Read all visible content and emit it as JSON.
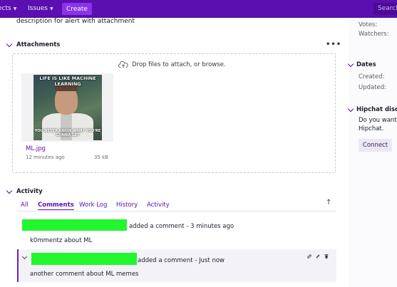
{
  "topbar": {
    "nav_items": [
      {
        "label": "ects",
        "has_caret": true
      },
      {
        "label": "Issues",
        "has_caret": true
      }
    ],
    "create_label": "Create",
    "search_placeholder": "Search"
  },
  "issue": {
    "description": "description for alert with attachment"
  },
  "attachments": {
    "heading": "Attachments",
    "more_label": "•••",
    "drop_text": "Drop files to attach, or browse.",
    "files": [
      {
        "name": "ML.jpg",
        "age": "12 minutes ago",
        "size": "35 kB",
        "meme_top": "LIFE IS LIKE MACHINE LEARNING",
        "meme_bottom": "YOU NEVER KNOW WHAT YOU'RE GONNA GET"
      }
    ]
  },
  "activity": {
    "heading": "Activity",
    "tabs": [
      {
        "label": "All",
        "active": false
      },
      {
        "label": "Comments",
        "active": true
      },
      {
        "label": "Work Log",
        "active": false
      },
      {
        "label": "History",
        "active": false
      },
      {
        "label": "Activity",
        "active": false
      }
    ],
    "sort_glyph": "↑",
    "comments": [
      {
        "meta": "added a comment - 3 minutes ago",
        "body": "k0mmentz about ML"
      },
      {
        "meta": "added a comment - Just now",
        "body": "another comment about ML memes"
      }
    ]
  },
  "sidebar": {
    "votes_label": "Votes:",
    "watchers_label": "Watchers:",
    "dates_heading": "Dates",
    "created_label": "Created:",
    "updated_label": "Updated:",
    "hipchat_heading": "Hipchat discu",
    "hipchat_line1": "Do you want",
    "hipchat_line2": "Hipchat.",
    "connect_label": "Connect"
  },
  "colors": {
    "brand": "#5b0fb0",
    "create": "#8a33e8",
    "redaction": "#21f62e"
  },
  "icons": [
    "caret-down-icon",
    "chevron-down-icon",
    "cloud-upload-icon",
    "more-icon",
    "sort-arrow-icon",
    "link-icon",
    "edit-icon",
    "delete-icon"
  ]
}
